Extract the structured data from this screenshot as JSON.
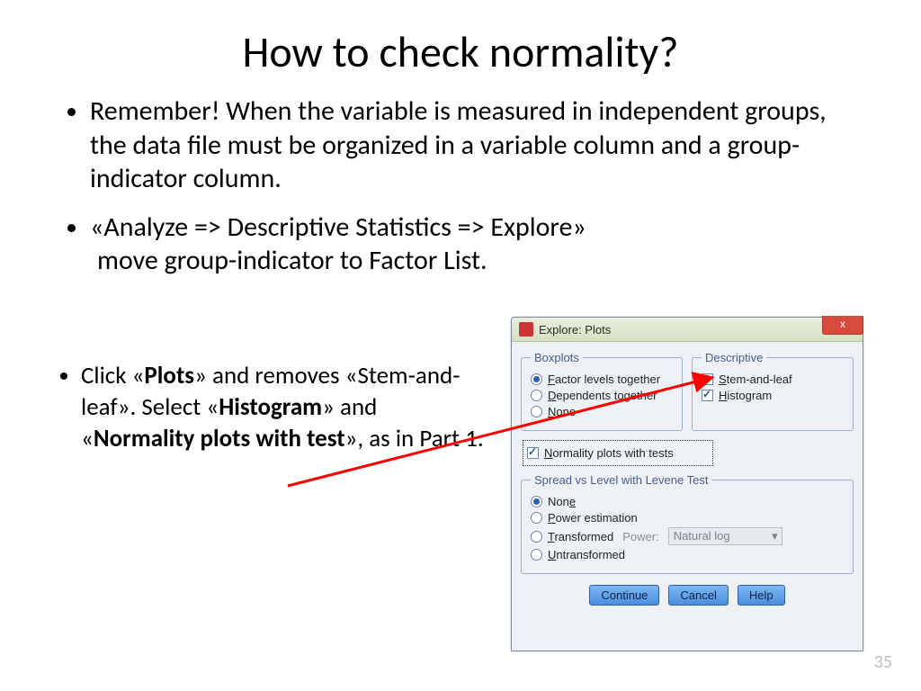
{
  "title": "How to check normality?",
  "bullets": {
    "b1": "Remember! When the variable is measured in independent groups, the data file must be organized in a variable column and a group-indicator column.",
    "b2_line1": "«Analyze => Descriptive Statistics => Explore»",
    "b2_line2": "move group-indicator to Factor List."
  },
  "lower": {
    "prefix": "Click «",
    "plots": "Plots",
    "mid1": "» and removes «Stem-and-leaf». Select «",
    "histogram": "Histogram",
    "mid2": "» and «",
    "normtest": "Normality plots with test",
    "suffix": "», as in Part 1."
  },
  "dialog": {
    "title": "Explore: Plots",
    "close": "x",
    "boxplots": {
      "legend": "Boxplots",
      "opt1": "Factor levels together",
      "opt1_u": "F",
      "opt2": "Dependents together",
      "opt2_u": "D",
      "opt3": "None",
      "opt3_u": "N"
    },
    "descriptive": {
      "legend": "Descriptive",
      "opt1": "Stem-and-leaf",
      "opt1_u": "S",
      "opt2": "Histogram",
      "opt2_u": "H"
    },
    "normality": "Normality plots with tests",
    "normality_u": "N",
    "spread": {
      "legend": "Spread vs Level with Levene Test",
      "opt1": "None",
      "opt1_u": "e",
      "opt2": "Power estimation",
      "opt2_u": "P",
      "opt3": "Transformed",
      "opt3_u": "T",
      "power_label": "Power:",
      "power_value": "Natural log",
      "opt4": "Untransformed",
      "opt4_u": "U"
    },
    "buttons": {
      "continue": "Continue",
      "cancel": "Cancel",
      "help": "Help"
    }
  },
  "page_number": "35"
}
